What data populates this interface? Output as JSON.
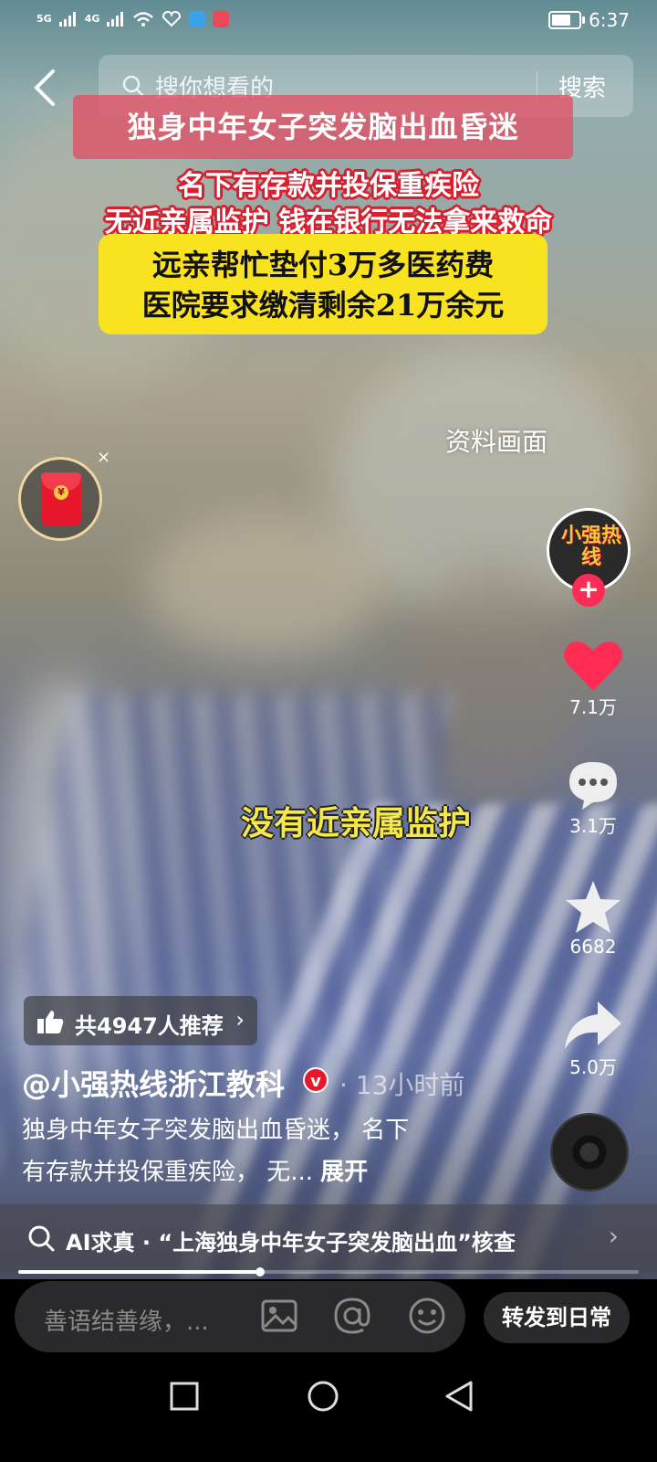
{
  "status_bar": {
    "signal_1": "5G",
    "signal_2": "4G",
    "time": "6:37"
  },
  "search": {
    "placeholder": "搜你想看的",
    "button": "搜索"
  },
  "video": {
    "title_caption": "独身中年女子突发脑出血昏迷",
    "red_caption_line1": "名下有存款并投保重疾险",
    "red_caption_line2": "无近亲属监护 钱在银行无法拿来救命",
    "yellow_caption_line1": "远亲帮忙垫付3万多医药费",
    "yellow_caption_line2": "医院要求缴清剩余21万余元",
    "source_tag": "资料画面",
    "subtitle": "没有近亲属监护",
    "progress_fraction": 0.39
  },
  "red_packet": {
    "close": "×",
    "coin": "¥"
  },
  "actions": {
    "avatar_text": "小强热线",
    "follow": "+",
    "likes": "7.1万",
    "comments": "3.1万",
    "favorites": "6682",
    "shares": "5.0万"
  },
  "recommend": {
    "text": "共4947人推荐",
    "arrow": "›"
  },
  "author": {
    "name": "@小强热线浙江教科",
    "verified": "v",
    "time": "· 13小时前"
  },
  "description": {
    "text_line1": "独身中年女子突发脑出血昏迷， 名下",
    "text_line2": "有存款并投保重疾险， 无...",
    "expand": "展开"
  },
  "ai_check": {
    "text": "AI求真 · “上海独身中年女子突发脑出血”核查",
    "arrow": "›"
  },
  "comment_bar": {
    "placeholder": "善语结善缘，...",
    "share_button": "转发到日常"
  },
  "icons": {
    "back": "chevron-left-icon",
    "search": "search-icon",
    "like": "heart-icon",
    "comment": "comment-icon",
    "favorite": "star-icon",
    "share": "share-arrow-icon",
    "music": "music-disc-icon",
    "image": "image-icon",
    "mention": "at-icon",
    "emoji": "emoji-icon",
    "nav_recent": "square-icon",
    "nav_home": "circle-icon",
    "nav_back": "triangle-back-icon"
  },
  "colors": {
    "like": "#fe2c55",
    "caption_yellow": "#f9e21f",
    "caption_red": "#d6202f",
    "subtitle": "#f5e84a"
  }
}
